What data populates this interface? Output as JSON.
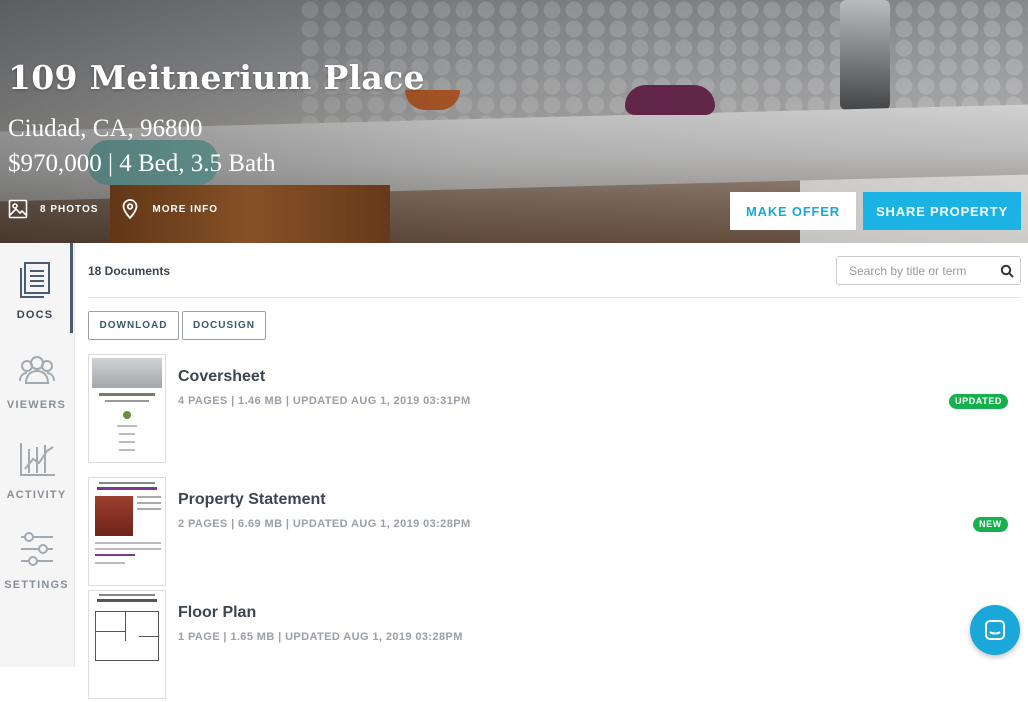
{
  "hero": {
    "title": "109 Meitnerium Place",
    "address": "Ciudad, CA, 96800",
    "price_line": "$970,000 | 4 Bed, 3.5 Bath",
    "photos_label": "8 PHOTOS",
    "more_info_label": "MORE INFO",
    "make_offer_label": "MAKE OFFER",
    "share_label": "SHARE PROPERTY"
  },
  "sidebar": {
    "items": [
      {
        "label": "DOCS",
        "icon": "docs-icon",
        "active": true
      },
      {
        "label": "VIEWERS",
        "icon": "viewers-icon",
        "active": false
      },
      {
        "label": "ACTIVITY",
        "icon": "activity-icon",
        "active": false
      },
      {
        "label": "SETTINGS",
        "icon": "settings-icon",
        "active": false
      }
    ]
  },
  "main": {
    "doc_count": "18 Documents",
    "search_placeholder": "Search by title or term",
    "download_label": "DOWNLOAD",
    "docusign_label": "DOCUSIGN",
    "documents": [
      {
        "title": "Coversheet",
        "meta": "4 PAGES | 1.46 MB | UPDATED AUG 1, 2019 03:31PM",
        "badge": "UPDATED"
      },
      {
        "title": "Property Statement",
        "meta": "2 PAGES | 6.69 MB | UPDATED AUG 1, 2019 03:28PM",
        "badge": "NEW"
      },
      {
        "title": "Floor Plan",
        "meta": "1 PAGE | 1.65 MB | UPDATED AUG 1, 2019 03:28PM",
        "badge": ""
      }
    ]
  },
  "colors": {
    "accent": "#1ab3e3",
    "badge_green": "#16b04d",
    "text_dark": "#3d4650"
  }
}
